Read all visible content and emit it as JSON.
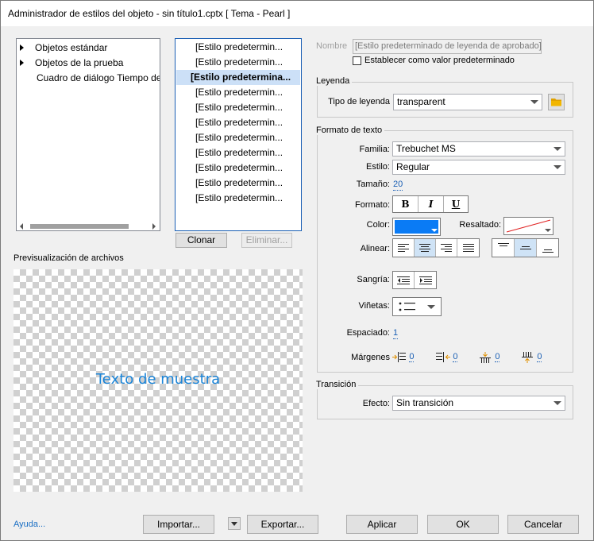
{
  "window": {
    "title": "Administrador de estilos del objeto - sin título1.cptx [ Tema - Pearl ]"
  },
  "tree": {
    "items": [
      {
        "label": "Objetos estándar",
        "expandable": true
      },
      {
        "label": "Objetos de la prueba",
        "expandable": true
      },
      {
        "label": "Cuadro de diálogo Tiempo de",
        "expandable": false
      }
    ]
  },
  "styles": {
    "items": [
      "[Estilo predetermin...",
      "[Estilo predetermin...",
      "[Estilo predetermina...",
      "[Estilo predetermin...",
      "[Estilo predetermin...",
      "[Estilo predetermin...",
      "[Estilo predetermin...",
      "[Estilo predetermin...",
      "[Estilo predetermin...",
      "[Estilo predetermin...",
      "[Estilo predetermin..."
    ],
    "selected_index": 2
  },
  "buttons": {
    "clone": "Clonar",
    "delete": "Eliminar...",
    "help": "Ayuda...",
    "import": "Importar...",
    "export": "Exportar...",
    "apply": "Aplicar",
    "ok": "OK",
    "cancel": "Cancelar"
  },
  "preview": {
    "heading": "Previsualización de archivos",
    "sample_text": "Texto de muestra",
    "sample_color": "#1a84d8"
  },
  "name": {
    "label": "Nombre",
    "value": "[Estilo predeterminado de leyenda de aprobado]",
    "default_checkbox": "Establecer como valor predeterminado"
  },
  "caption": {
    "group": "Leyenda",
    "type_label": "Tipo de leyenda",
    "type_value": "transparent"
  },
  "text_format": {
    "group": "Formato de texto",
    "family_label": "Familia:",
    "family_value": "Trebuchet MS",
    "style_label": "Estilo:",
    "style_value": "Regular",
    "size_label": "Tamaño:",
    "size_value": "20",
    "format_label": "Formato:",
    "bold": "B",
    "italic": "I",
    "underline": "U",
    "color_label": "Color:",
    "color_value": "#0a7bf5",
    "highlight_label": "Resaltado:",
    "align_label": "Alinear:",
    "indent_label": "Sangría:",
    "bullets_label": "Viñetas:",
    "spacing_label": "Espaciado:",
    "spacing_value": "1",
    "margins_label": "Márgenes",
    "margins": [
      "0",
      "0",
      "0",
      "0"
    ]
  },
  "transition": {
    "group": "Transición",
    "effect_label": "Efecto:",
    "effect_value": "Sin transición"
  }
}
